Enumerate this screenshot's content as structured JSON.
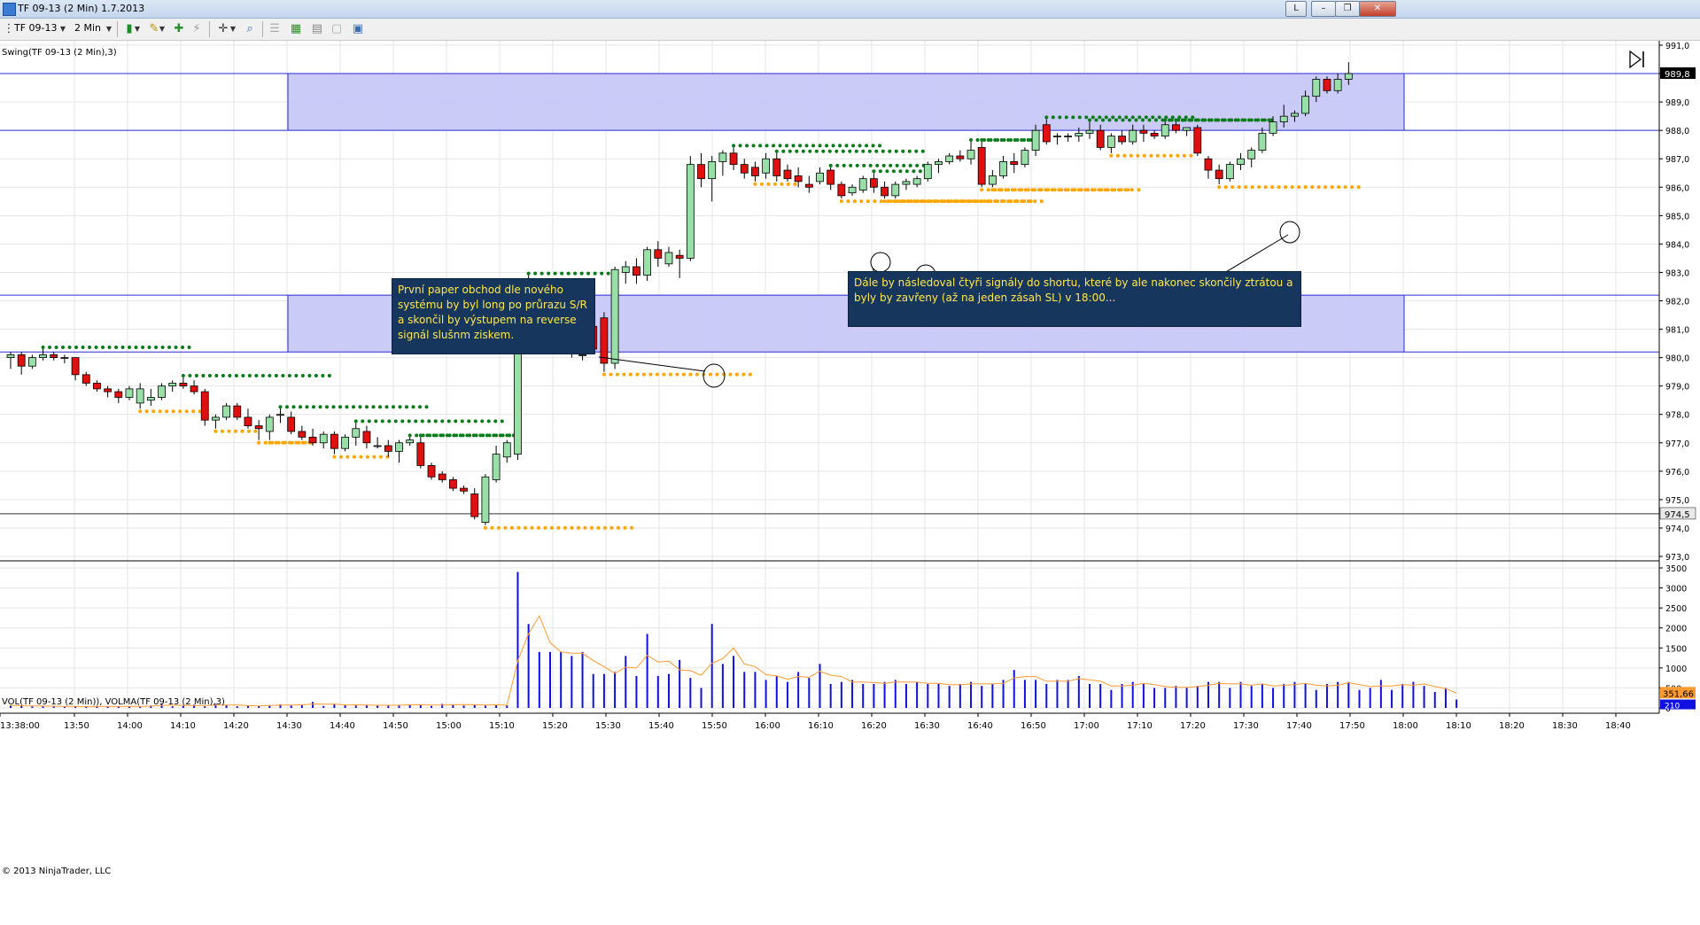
{
  "window": {
    "title": "TF 09-13 (2 Min)  1.7.2013",
    "min_label": "L"
  },
  "toolbar": {
    "instrument": "TF 09-13",
    "interval": "2 Min"
  },
  "price_panel": {
    "indicator_label": "Swing(TF 09-13 (2 Min),3)",
    "y_ticks": [
      "991,0",
      "990,0",
      "989,0",
      "988,0",
      "987,0",
      "986,0",
      "985,0",
      "984,0",
      "983,0",
      "982,0",
      "981,0",
      "980,0",
      "979,0",
      "978,0",
      "977,0",
      "976,0",
      "975,0",
      "974,0",
      "973,0"
    ],
    "last_price_label": "989,8",
    "line_label": "974,5"
  },
  "volume_panel": {
    "indicator_label": "VOL(TF 09-13 (2 Min)), VOLMA(TF 09-13 (2 Min),3)",
    "y_ticks": [
      "3500",
      "3000",
      "2500",
      "2000",
      "1500",
      "1000",
      "500",
      "0"
    ],
    "volma_label": "351,66",
    "vol_label": "210",
    "copyright": "© 2013 NinjaTrader, LLC"
  },
  "x_ticks": [
    "13:38:00",
    "13:50",
    "14:00",
    "14:10",
    "14:20",
    "14:30",
    "14:40",
    "14:50",
    "15:00",
    "15:10",
    "15:20",
    "15:30",
    "15:40",
    "15:50",
    "16:00",
    "16:10",
    "16:20",
    "16:30",
    "16:40",
    "16:50",
    "17:00",
    "17:10",
    "17:20",
    "17:30",
    "17:40",
    "17:50",
    "18:00",
    "18:10",
    "18:20",
    "18:30",
    "18:40"
  ],
  "annotations": [
    {
      "text": "První paper obchod dle nového systému by byl long po průrazu S/R a skončil by výstupem na reverse signál slušnm ziskem."
    },
    {
      "text": "Dále by následoval čtyři signály do shortu, které by ale nakonec skončily ztrátou a byly by zavřeny (až na jeden zásah SL) v 18:00..."
    }
  ],
  "colors": {
    "zone_fill": "#c8c8f8",
    "zone_line": "#2b2bd6",
    "up_candle": "#98e0a8",
    "down_candle": "#e01010",
    "swing_high": "#0a7a1a",
    "swing_low": "#ffa500",
    "volume": "#1010e0",
    "volma": "#ff9a30",
    "note_bg": "#17365d",
    "note_text": "#ffe84a"
  },
  "chart_data": {
    "type": "candlestick",
    "interval": "2 Min",
    "instrument": "TF 09-13",
    "candles_ohlc": [
      [
        980.0,
        980.2,
        979.6,
        980.1
      ],
      [
        980.1,
        980.2,
        979.4,
        979.7
      ],
      [
        979.7,
        980.1,
        979.6,
        980.0
      ],
      [
        980.0,
        980.3,
        979.9,
        980.1
      ],
      [
        980.1,
        980.2,
        979.9,
        980.0
      ],
      [
        980.0,
        980.1,
        979.8,
        980.0
      ],
      [
        980.0,
        980.0,
        979.2,
        979.4
      ],
      [
        979.4,
        979.5,
        979.0,
        979.1
      ],
      [
        979.1,
        979.2,
        978.8,
        978.9
      ],
      [
        978.9,
        979.0,
        978.6,
        978.8
      ],
      [
        978.8,
        978.9,
        978.4,
        978.6
      ],
      [
        978.6,
        979.0,
        978.5,
        978.9
      ],
      [
        978.4,
        979.1,
        978.2,
        978.9
      ],
      [
        978.5,
        978.9,
        978.3,
        978.6
      ],
      [
        978.6,
        979.1,
        978.5,
        979.0
      ],
      [
        979.0,
        979.2,
        978.8,
        979.1
      ],
      [
        979.1,
        979.3,
        978.9,
        979.0
      ],
      [
        979.0,
        979.2,
        978.7,
        978.8
      ],
      [
        978.8,
        978.9,
        977.6,
        977.8
      ],
      [
        977.8,
        978.0,
        977.5,
        977.9
      ],
      [
        977.9,
        978.4,
        977.8,
        978.3
      ],
      [
        978.3,
        978.4,
        977.8,
        977.9
      ],
      [
        977.9,
        978.2,
        977.5,
        977.6
      ],
      [
        977.6,
        977.8,
        977.1,
        977.5
      ],
      [
        977.4,
        978.0,
        977.1,
        977.9
      ],
      [
        978.0,
        978.2,
        977.7,
        978.0
      ],
      [
        977.9,
        978.1,
        977.3,
        977.4
      ],
      [
        977.4,
        977.6,
        977.1,
        977.2
      ],
      [
        977.2,
        977.5,
        976.9,
        977.0
      ],
      [
        977.0,
        977.4,
        976.8,
        977.3
      ],
      [
        977.3,
        977.4,
        976.6,
        976.8
      ],
      [
        976.8,
        977.3,
        976.7,
        977.2
      ],
      [
        977.2,
        977.7,
        976.9,
        977.5
      ],
      [
        977.4,
        977.6,
        976.8,
        977.0
      ],
      [
        976.9,
        977.2,
        976.8,
        976.9
      ],
      [
        976.9,
        977.1,
        976.5,
        976.7
      ],
      [
        976.7,
        977.1,
        976.3,
        977.0
      ],
      [
        977.0,
        977.2,
        976.9,
        977.1
      ],
      [
        977.0,
        977.2,
        976.1,
        976.2
      ],
      [
        976.2,
        976.3,
        975.7,
        975.8
      ],
      [
        975.9,
        976.0,
        975.6,
        975.7
      ],
      [
        975.7,
        975.8,
        975.3,
        975.4
      ],
      [
        975.4,
        975.5,
        975.2,
        975.3
      ],
      [
        975.2,
        975.4,
        974.3,
        974.4
      ],
      [
        974.2,
        975.9,
        974.1,
        975.8
      ],
      [
        975.7,
        976.9,
        975.6,
        976.6
      ],
      [
        976.5,
        977.1,
        976.3,
        977.0
      ],
      [
        976.6,
        981.4,
        976.4,
        981.2
      ],
      [
        980.9,
        982.9,
        980.4,
        981.6
      ],
      [
        981.8,
        982.5,
        981.1,
        981.2
      ],
      [
        981.8,
        982.3,
        980.4,
        980.7
      ],
      [
        981.0,
        981.3,
        980.4,
        980.5
      ],
      [
        981.2,
        981.5,
        980.0,
        980.2
      ],
      [
        980.1,
        980.6,
        979.9,
        980.1
      ],
      [
        981.1,
        981.2,
        980.2,
        980.3
      ],
      [
        981.4,
        981.6,
        979.5,
        979.8
      ],
      [
        979.8,
        983.2,
        979.6,
        983.1
      ],
      [
        983.0,
        983.4,
        982.6,
        983.2
      ],
      [
        983.2,
        983.5,
        982.6,
        982.9
      ],
      [
        982.9,
        983.9,
        982.7,
        983.8
      ],
      [
        983.8,
        984.1,
        983.2,
        983.5
      ],
      [
        983.3,
        983.9,
        983.2,
        983.7
      ],
      [
        983.6,
        983.8,
        982.8,
        983.5
      ],
      [
        983.5,
        987.1,
        983.4,
        986.8
      ],
      [
        986.8,
        987.2,
        986.0,
        986.3
      ],
      [
        986.3,
        987.1,
        985.5,
        986.9
      ],
      [
        986.9,
        987.3,
        986.4,
        987.2
      ],
      [
        987.2,
        987.4,
        986.6,
        986.8
      ],
      [
        986.8,
        987.0,
        986.3,
        986.5
      ],
      [
        986.7,
        986.9,
        986.2,
        986.4
      ],
      [
        986.5,
        987.2,
        986.3,
        987.0
      ],
      [
        987.0,
        987.2,
        986.2,
        986.4
      ],
      [
        986.6,
        986.8,
        986.2,
        986.3
      ],
      [
        986.4,
        986.7,
        986.0,
        986.2
      ],
      [
        986.1,
        986.4,
        985.8,
        986.0
      ],
      [
        986.2,
        986.7,
        986.1,
        986.5
      ],
      [
        986.6,
        986.7,
        985.9,
        986.1
      ],
      [
        986.1,
        986.2,
        985.6,
        985.7
      ],
      [
        985.8,
        986.1,
        985.7,
        986.0
      ],
      [
        985.9,
        986.4,
        985.8,
        986.3
      ],
      [
        986.3,
        986.5,
        985.8,
        986.0
      ],
      [
        986.0,
        986.2,
        985.6,
        985.7
      ],
      [
        985.7,
        986.2,
        985.6,
        986.1
      ],
      [
        986.1,
        986.3,
        985.9,
        986.2
      ],
      [
        986.1,
        986.4,
        986.0,
        986.3
      ],
      [
        986.3,
        986.9,
        986.2,
        986.8
      ],
      [
        986.8,
        987.0,
        986.5,
        986.9
      ],
      [
        986.9,
        987.2,
        986.8,
        987.1
      ],
      [
        987.1,
        987.3,
        986.9,
        987.0
      ],
      [
        987.0,
        987.6,
        986.8,
        987.3
      ],
      [
        987.4,
        987.6,
        986.0,
        986.1
      ],
      [
        986.1,
        986.6,
        986.0,
        986.4
      ],
      [
        986.4,
        987.1,
        986.3,
        986.9
      ],
      [
        986.9,
        987.2,
        986.5,
        986.8
      ],
      [
        986.8,
        987.4,
        986.7,
        987.3
      ],
      [
        987.3,
        988.2,
        987.1,
        988.0
      ],
      [
        988.2,
        988.4,
        987.5,
        987.6
      ],
      [
        987.8,
        987.9,
        987.5,
        987.8
      ],
      [
        987.8,
        987.9,
        987.6,
        987.8
      ],
      [
        987.8,
        988.1,
        987.6,
        987.9
      ],
      [
        987.9,
        988.3,
        987.7,
        988.0
      ],
      [
        988.0,
        988.2,
        987.3,
        987.4
      ],
      [
        987.4,
        987.9,
        987.2,
        987.8
      ],
      [
        987.8,
        988.0,
        987.5,
        987.6
      ],
      [
        987.6,
        988.2,
        987.5,
        988.0
      ],
      [
        988.0,
        988.2,
        987.6,
        987.9
      ],
      [
        987.9,
        988.0,
        987.7,
        987.8
      ],
      [
        987.8,
        988.3,
        987.7,
        988.2
      ],
      [
        988.2,
        988.3,
        987.9,
        988.0
      ],
      [
        988.0,
        988.1,
        987.8,
        988.1
      ],
      [
        988.1,
        988.2,
        987.1,
        987.2
      ],
      [
        987.0,
        987.1,
        986.3,
        986.6
      ],
      [
        986.6,
        986.8,
        986.1,
        986.3
      ],
      [
        986.3,
        986.9,
        986.2,
        986.8
      ],
      [
        986.8,
        987.2,
        986.6,
        987.0
      ],
      [
        987.0,
        987.4,
        986.7,
        987.3
      ],
      [
        987.3,
        988.1,
        987.2,
        987.9
      ],
      [
        987.9,
        988.5,
        987.8,
        988.3
      ],
      [
        988.3,
        988.9,
        988.1,
        988.5
      ],
      [
        988.5,
        988.7,
        988.3,
        988.6
      ],
      [
        988.6,
        989.4,
        988.5,
        989.2
      ],
      [
        989.2,
        989.9,
        989.0,
        989.8
      ],
      [
        989.8,
        989.9,
        989.3,
        989.4
      ],
      [
        989.4,
        990.0,
        989.3,
        989.8
      ],
      [
        989.8,
        990.4,
        989.6,
        990.0
      ]
    ],
    "volume": [
      60,
      50,
      40,
      50,
      40,
      30,
      40,
      30,
      50,
      30,
      40,
      40,
      30,
      60,
      100,
      40,
      50,
      80,
      40,
      100,
      70,
      40,
      60,
      50,
      70,
      90,
      60,
      80,
      150,
      50,
      90,
      80,
      60,
      80,
      60,
      60,
      80,
      90,
      70,
      50,
      100,
      90,
      60,
      90,
      60,
      80,
      60,
      3400,
      2100,
      1400,
      1400,
      1400,
      1300,
      1400,
      850,
      850,
      900,
      1300,
      800,
      1850,
      800,
      850,
      1200,
      750,
      500,
      2100,
      1100,
      1300,
      900,
      900,
      700,
      800,
      650,
      900,
      750,
      1100,
      600,
      650,
      700,
      600,
      600,
      650,
      700,
      600,
      650,
      600,
      600,
      550,
      600,
      650,
      550,
      600,
      700,
      950,
      700,
      700,
      600,
      700,
      700,
      800,
      600,
      600,
      450,
      600,
      650,
      600,
      500,
      500,
      550,
      500,
      550,
      650,
      650,
      500,
      650,
      550,
      600,
      500,
      600,
      650,
      600,
      450,
      600,
      650,
      650,
      450,
      500,
      700,
      450,
      600,
      650,
      550,
      400,
      500,
      210
    ],
    "y_range": [
      973.0,
      991.0
    ],
    "volume_range": [
      0,
      3500
    ],
    "zones": [
      {
        "from": 988.0,
        "to": 990.0
      },
      {
        "from": 980.2,
        "to": 982.2
      }
    ],
    "horizontal_line": 974.5
  }
}
